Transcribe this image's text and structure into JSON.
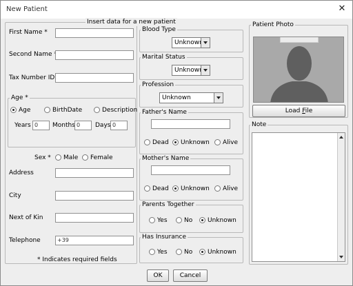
{
  "window": {
    "title": "New Patient"
  },
  "form": {
    "header": "Insert data for a new patient",
    "first_name_label": "First Name *",
    "second_name_label": "Second Name *",
    "tax_number_label": "Tax Number ID",
    "age_group": {
      "legend": "Age *",
      "options": [
        "Age",
        "BirthDate",
        "Description"
      ],
      "selected": "Age",
      "years_label": "Years",
      "years_value": "0",
      "months_label": "Months",
      "months_value": "0",
      "days_label": "Days",
      "days_value": "0"
    },
    "sex": {
      "label": "Sex *",
      "options": [
        "Male",
        "Female"
      ]
    },
    "address_label": "Address",
    "city_label": "City",
    "next_of_kin_label": "Next of Kin",
    "telephone_label": "Telephone",
    "telephone_value": "+39",
    "required_note": "* Indicates required fields"
  },
  "middle": {
    "blood_type": {
      "legend": "Blood Type",
      "value": "Unknown"
    },
    "marital_status": {
      "legend": "Marital Status",
      "value": "Unknown"
    },
    "profession": {
      "legend": "Profession",
      "value": "Unknown"
    },
    "father": {
      "legend": "Father's Name",
      "options": [
        "Dead",
        "Unknown",
        "Alive"
      ],
      "selected": "Unknown"
    },
    "mother": {
      "legend": "Mother's Name",
      "options": [
        "Dead",
        "Unknown",
        "Alive"
      ],
      "selected": "Unknown"
    },
    "parents_together": {
      "legend": "Parents Together",
      "options": [
        "Yes",
        "No",
        "Unknown"
      ],
      "selected": "Unknown"
    },
    "has_insurance": {
      "legend": "Has Insurance",
      "options": [
        "Yes",
        "No",
        "Unknown"
      ],
      "selected": "Unknown"
    }
  },
  "right": {
    "photo_legend": "Patient Photo",
    "load_file_label": "Load File",
    "note_legend": "Note"
  },
  "buttons": {
    "ok": "OK",
    "cancel": "Cancel"
  }
}
